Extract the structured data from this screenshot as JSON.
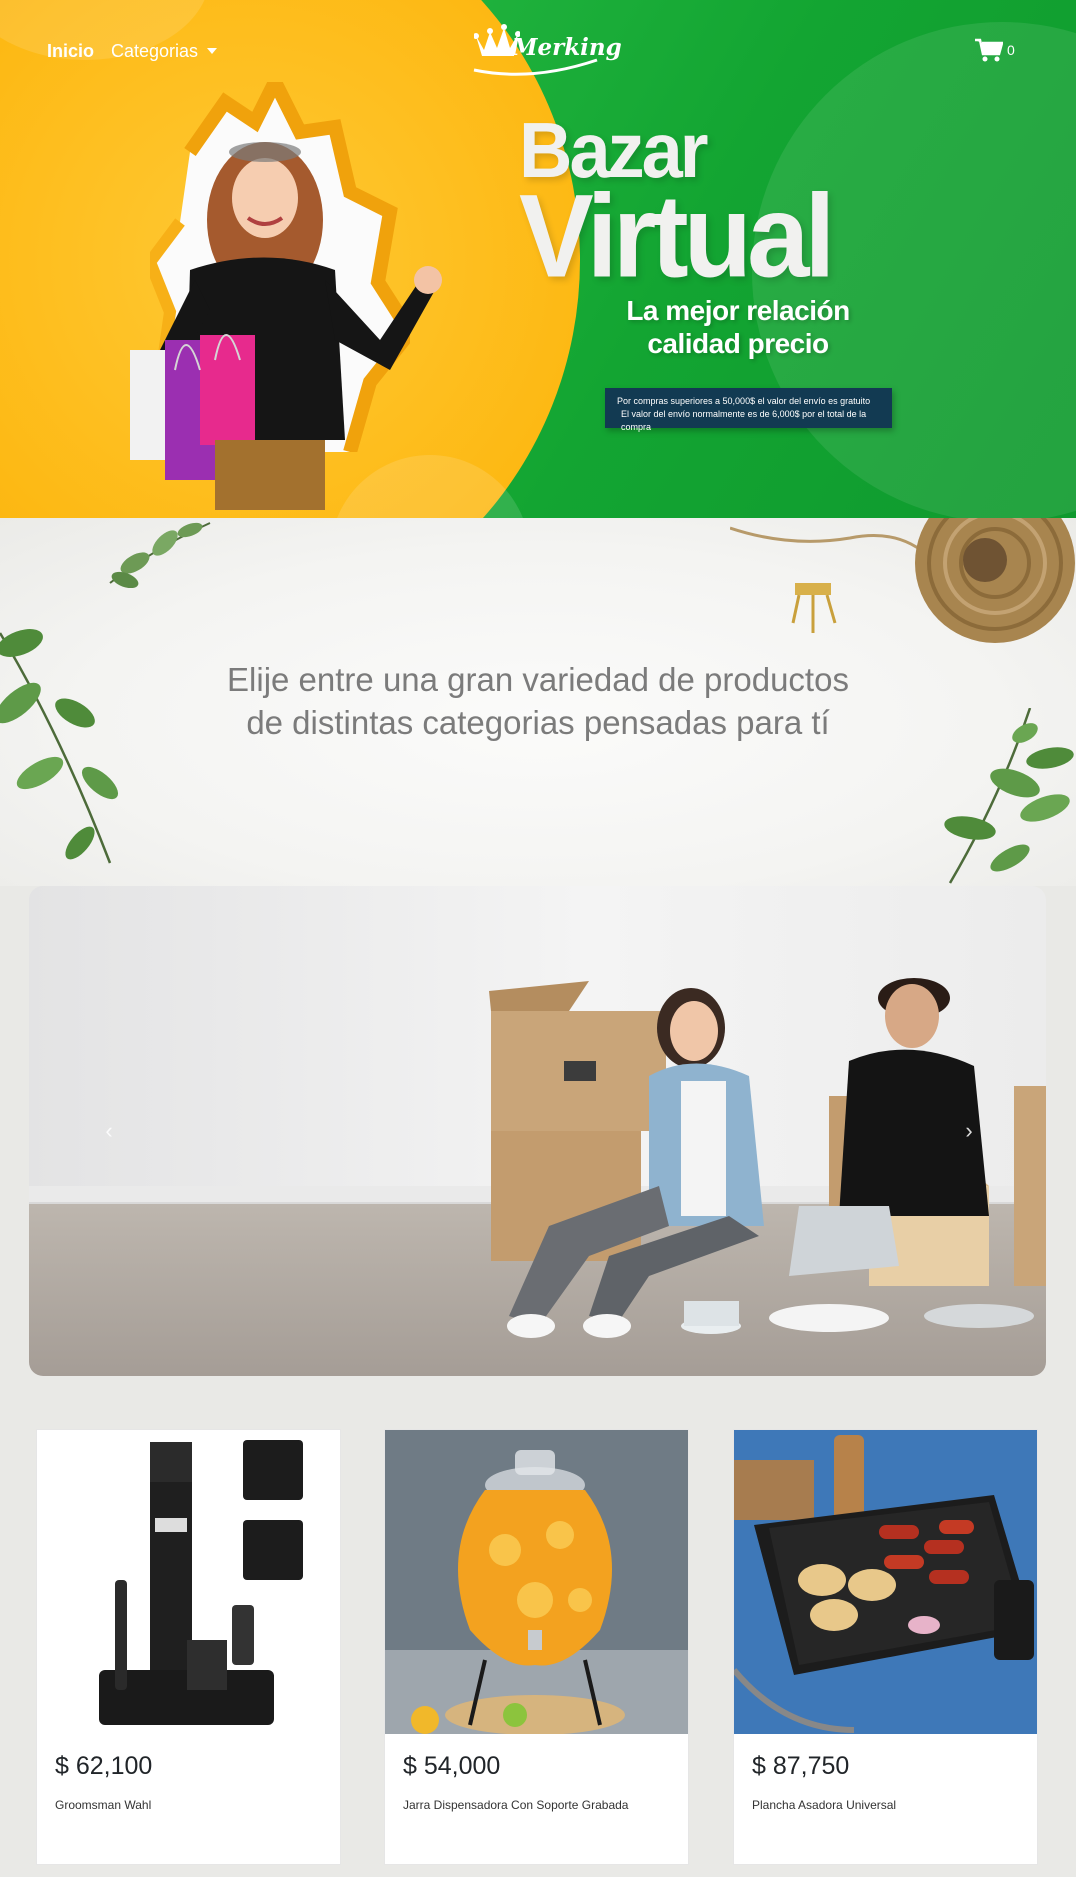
{
  "nav": {
    "home": "Inicio",
    "categories": "Categorias",
    "logo": "Merking",
    "cart_count": "0"
  },
  "hero": {
    "title_line1": "Bazar",
    "title_line2": "Virtual",
    "subtitle_line1": "La mejor relación",
    "subtitle_line2": "calidad precio",
    "notice_line1": "Por compras superiores a 50,000$ el valor del envío es gratuito",
    "notice_line2": "El valor del envío normalmente es de 6,000$ por el total de la compra"
  },
  "banner": {
    "line1": "Elije entre una gran variedad de productos",
    "line2": "de distintas categorias pensadas para tí"
  },
  "carousel": {
    "prev": "‹",
    "next": "›"
  },
  "products": [
    {
      "price": "$ 62,100",
      "name": "Groomsman Wahl"
    },
    {
      "price": "$ 54,000",
      "name": "Jarra Dispensadora Con Soporte Grabada"
    },
    {
      "price": "$ 87,750",
      "name": "Plancha Asadora Universal"
    }
  ],
  "colors": {
    "hero_yellow": "#fdb914",
    "hero_green": "#13a532",
    "notice_bg": "#123a52",
    "page_bg": "#e9e9e6"
  }
}
